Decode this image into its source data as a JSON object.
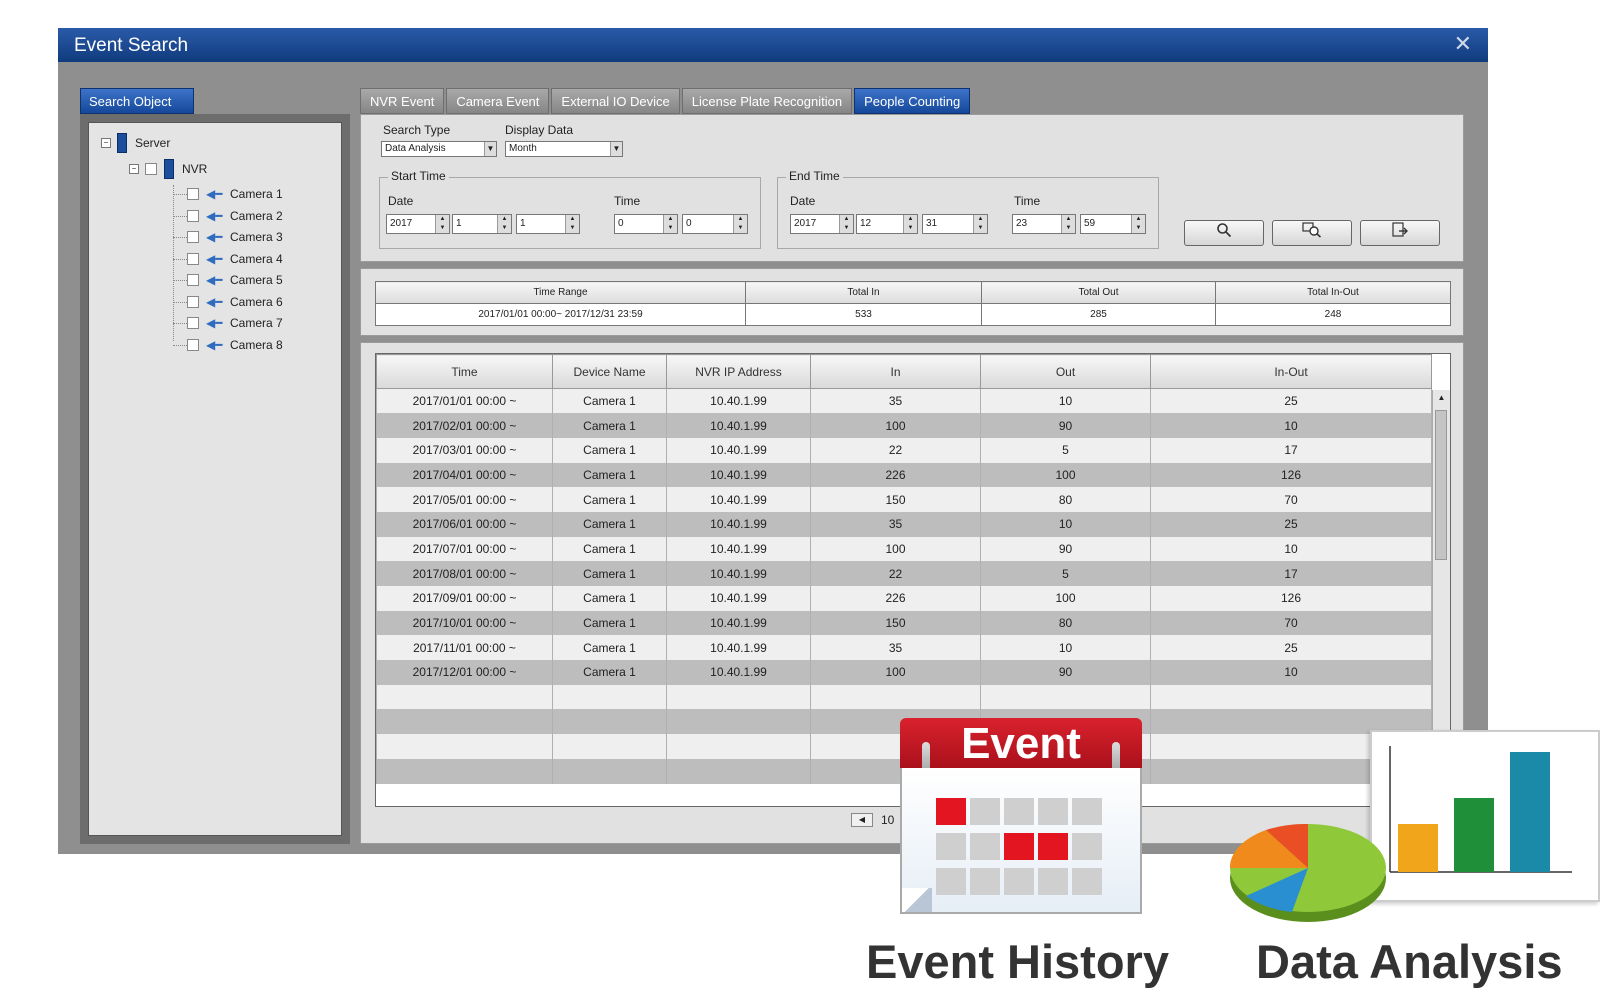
{
  "window": {
    "title": "Event Search",
    "close_glyph": "✕"
  },
  "search_object": {
    "tab_label": "Search Object",
    "server": "Server",
    "nvr": "NVR",
    "cameras": [
      "Camera 1",
      "Camera 2",
      "Camera 3",
      "Camera 4",
      "Camera 5",
      "Camera 6",
      "Camera 7",
      "Camera 8"
    ]
  },
  "tabs": [
    "NVR Event",
    "Camera Event",
    "External IO Device",
    "License Plate Recognition",
    "People Counting"
  ],
  "active_tab": "People Counting",
  "search": {
    "search_type_label": "Search Type",
    "search_type_value": "Data Analysis",
    "display_data_label": "Display Data",
    "display_data_value": "Month",
    "start_time": {
      "legend": "Start Time",
      "date_label": "Date",
      "time_label": "Time",
      "year": "2017",
      "month": "1",
      "day": "1",
      "hour": "0",
      "minute": "0"
    },
    "end_time": {
      "legend": "End Time",
      "date_label": "Date",
      "time_label": "Time",
      "year": "2017",
      "month": "12",
      "day": "31",
      "hour": "23",
      "minute": "59"
    },
    "icons": [
      "search-icon",
      "zoom-search-icon",
      "export-icon"
    ]
  },
  "summary": {
    "headers": [
      "Time Range",
      "Total In",
      "Total Out",
      "Total In-Out"
    ],
    "values": [
      "2017/01/01 00:00~ 2017/12/31 23:59",
      "533",
      "285",
      "248"
    ]
  },
  "results": {
    "headers": [
      "Time",
      "Device Name",
      "NVR IP Address",
      "In",
      "Out",
      "In-Out"
    ],
    "rows": [
      [
        "2017/01/01 00:00 ~",
        "Camera 1",
        "10.40.1.99",
        "35",
        "10",
        "25"
      ],
      [
        "2017/02/01 00:00 ~",
        "Camera 1",
        "10.40.1.99",
        "100",
        "90",
        "10"
      ],
      [
        "2017/03/01 00:00 ~",
        "Camera 1",
        "10.40.1.99",
        "22",
        "5",
        "17"
      ],
      [
        "2017/04/01 00:00 ~",
        "Camera 1",
        "10.40.1.99",
        "226",
        "100",
        "126"
      ],
      [
        "2017/05/01 00:00 ~",
        "Camera 1",
        "10.40.1.99",
        "150",
        "80",
        "70"
      ],
      [
        "2017/06/01 00:00 ~",
        "Camera 1",
        "10.40.1.99",
        "35",
        "10",
        "25"
      ],
      [
        "2017/07/01 00:00 ~",
        "Camera 1",
        "10.40.1.99",
        "100",
        "90",
        "10"
      ],
      [
        "2017/08/01 00:00 ~",
        "Camera 1",
        "10.40.1.99",
        "22",
        "5",
        "17"
      ],
      [
        "2017/09/01 00:00 ~",
        "Camera 1",
        "10.40.1.99",
        "226",
        "100",
        "126"
      ],
      [
        "2017/10/01 00:00 ~",
        "Camera 1",
        "10.40.1.99",
        "150",
        "80",
        "70"
      ],
      [
        "2017/11/01 00:00 ~",
        "Camera 1",
        "10.40.1.99",
        "35",
        "10",
        "25"
      ],
      [
        "2017/12/01 00:00 ~",
        "Camera 1",
        "10.40.1.99",
        "100",
        "90",
        "10"
      ]
    ],
    "empty_rows": 4,
    "pager_text": "10"
  },
  "overlay": {
    "calendar_title": "Event",
    "caption_left": "Event History",
    "caption_right": "Data Analysis"
  },
  "colors": {
    "title_blue": "#1a4a94",
    "accent_red": "#d9222d"
  }
}
